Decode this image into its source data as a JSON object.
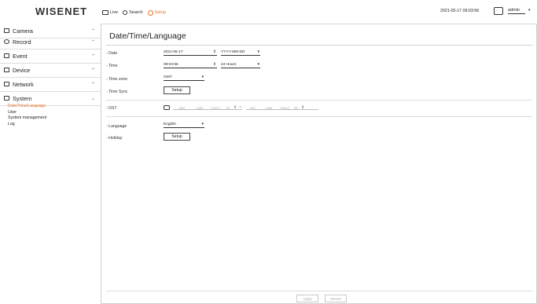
{
  "header": {
    "logo": "WISENET",
    "nav": [
      {
        "label": "Live",
        "icon": "monitor-icon"
      },
      {
        "label": "Search",
        "icon": "search-icon"
      },
      {
        "label": "Setup",
        "icon": "gear-icon",
        "active": true
      }
    ],
    "datetime": "2021-05-17 09:03:56",
    "user": "admin"
  },
  "sidebar": {
    "items": [
      {
        "label": "Camera",
        "icon": "camera-icon",
        "chevron": "^"
      },
      {
        "label": "Record",
        "icon": "record-icon",
        "chevron": "^"
      },
      {
        "label": "Event",
        "icon": "event-icon",
        "chevron": "^"
      },
      {
        "label": "Device",
        "icon": "device-icon",
        "chevron": "^"
      },
      {
        "label": "Network",
        "icon": "network-icon",
        "chevron": "^"
      },
      {
        "label": "System",
        "icon": "system-icon",
        "chevron": "v"
      }
    ],
    "submenu": [
      {
        "label": "Date/Time/Language",
        "active": true
      },
      {
        "label": "User"
      },
      {
        "label": "System management"
      },
      {
        "label": "Log"
      }
    ]
  },
  "main": {
    "title": "Date/Time/Language",
    "date": {
      "label": "- Date",
      "value": "2021-05-17",
      "format": "YYYY-MM-DD"
    },
    "time": {
      "label": "- Time",
      "value": "09:03:56",
      "format": "24 Hours"
    },
    "timezone": {
      "label": "- Time zone",
      "value": "GMT"
    },
    "timesync": {
      "label": "- Time Sync",
      "button": "Setup"
    },
    "dst": {
      "label": "- DST",
      "start": {
        "month": "Mar",
        "week": "Last",
        "day": "[ Sun ]",
        "hour": "01"
      },
      "end": {
        "month": "Oct",
        "week": "Last",
        "day": "[ Sun ]",
        "hour": "01"
      },
      "separator": "~"
    },
    "language": {
      "label": "- Language",
      "value": "English"
    },
    "holiday": {
      "label": "- Holiday",
      "button": "Setup"
    }
  },
  "footer": {
    "apply": "Apply",
    "revert": "Revert"
  }
}
